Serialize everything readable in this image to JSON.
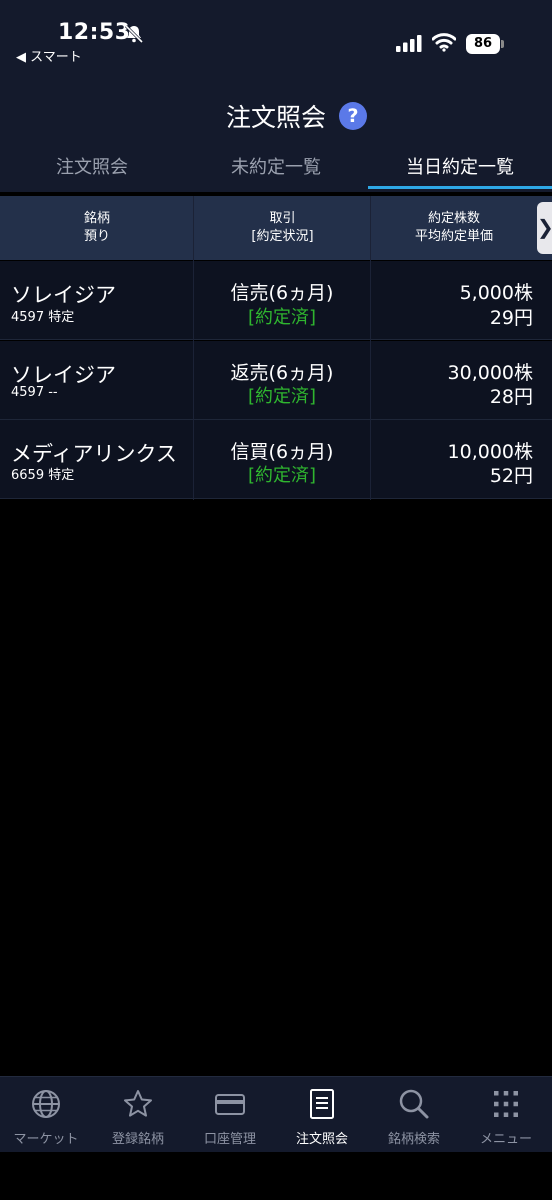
{
  "status_bar": {
    "time": "12:53",
    "back_app": "◀ スマート",
    "battery": "86"
  },
  "header": {
    "title": "注文照会",
    "help": "?"
  },
  "tabs": [
    {
      "label": "注文照会"
    },
    {
      "label": "未約定一覧"
    },
    {
      "label": "当日約定一覧"
    }
  ],
  "table": {
    "headers": [
      {
        "line1": "銘柄",
        "line2": "預り"
      },
      {
        "line1": "取引",
        "line2": "[約定状況]"
      },
      {
        "line1": "約定株数",
        "line2": "平均約定単価"
      }
    ],
    "scroll_glyph": "❯",
    "rows": [
      {
        "name": "ソレイジア",
        "code": "4597 特定",
        "trade": "信売(6ヵ月)",
        "status": "[約定済]",
        "qty": "5,000株",
        "price": "29円"
      },
      {
        "name": "ソレイジア",
        "code": "4597 --",
        "trade": "返売(6ヵ月)",
        "status": "[約定済]",
        "qty": "30,000株",
        "price": "28円"
      },
      {
        "name": "メディアリンクス",
        "code": "6659 特定",
        "trade": "信買(6ヵ月)",
        "status": "[約定済]",
        "qty": "10,000株",
        "price": "52円"
      }
    ]
  },
  "bottom_nav": [
    {
      "label": "マーケット",
      "icon": "globe-icon"
    },
    {
      "label": "登録銘柄",
      "icon": "star-icon"
    },
    {
      "label": "口座管理",
      "icon": "card-icon"
    },
    {
      "label": "注文照会",
      "icon": "document-icon"
    },
    {
      "label": "銘柄検索",
      "icon": "search-icon"
    },
    {
      "label": "メニュー",
      "icon": "grid-icon"
    }
  ],
  "colors": {
    "accent": "#2ea8e6",
    "help_badge": "#5b79e8",
    "status_filled": "#2fb52f",
    "header_bg": "#141a2c",
    "table_header_bg": "#23304a"
  }
}
